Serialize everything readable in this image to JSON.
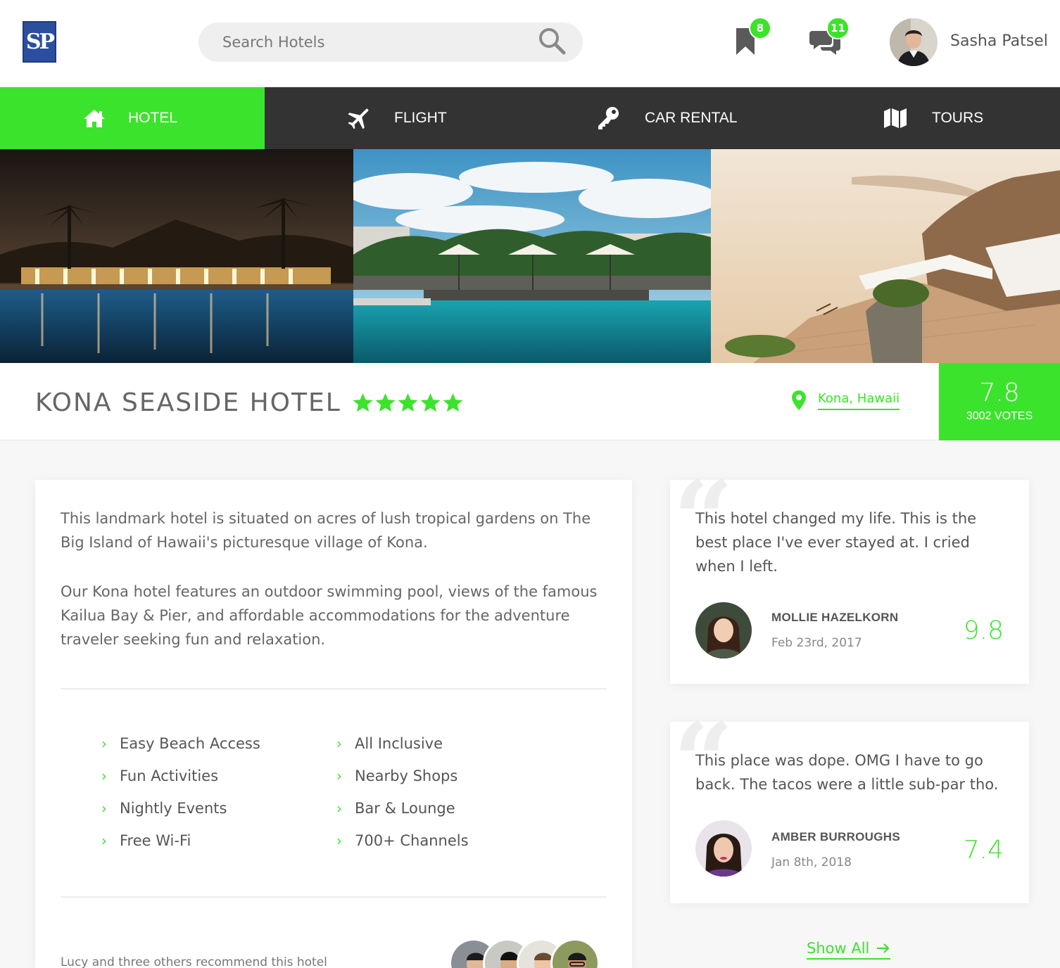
{
  "header": {
    "logo_text": "SP",
    "search_placeholder": "Search Hotels",
    "bookmarks_count": "8",
    "messages_count": "11",
    "user_name": "Sasha Patsel"
  },
  "nav": {
    "items": [
      {
        "label": "HOTEL",
        "icon": "home-icon",
        "active": true
      },
      {
        "label": "FLIGHT",
        "icon": "plane-icon",
        "active": false
      },
      {
        "label": "CAR RENTAL",
        "icon": "key-icon",
        "active": false
      },
      {
        "label": "TOURS",
        "icon": "map-icon",
        "active": false
      }
    ]
  },
  "hotel": {
    "title": "KONA SEASIDE HOTEL",
    "stars": 5,
    "location": "Kona, Hawaii",
    "score": "7.8",
    "votes": "3002 VOTES",
    "description": [
      "This landmark hotel is situated on acres of lush tropical gardens on The Big Island of Hawaii's picturesque village of Kona.",
      "Our Kona hotel features an outdoor swimming pool, views of the famous Kailua Bay & Pier, and affordable accommodations for the adventure traveler seeking fun and relaxation."
    ],
    "amenities_left": [
      "Easy Beach Access",
      "Fun Activities",
      "Nightly Events",
      "Free Wi-Fi"
    ],
    "amenities_right": [
      "All Inclusive",
      "Nearby Shops",
      "Bar & Lounge",
      "700+ Channels"
    ],
    "recommend_text": "Lucy and three others recommend this hotel"
  },
  "reviews": [
    {
      "text": "This hotel changed my life. This is the best place I've ever stayed at. I cried when I left.",
      "name": "MOLLIE HAZELKORN",
      "date": "Feb 23rd, 2017",
      "score": "9.8"
    },
    {
      "text": "This place was dope. OMG I have to go back. The tacos were a little sub-par tho.",
      "name": "AMBER BURROUGHS",
      "date": "Jan 8th, 2018",
      "score": "7.4"
    }
  ],
  "show_all_label": "Show All",
  "colors": {
    "accent": "#3ce32c",
    "nav_bg": "#333333",
    "page_bg": "#f7f7f7"
  }
}
